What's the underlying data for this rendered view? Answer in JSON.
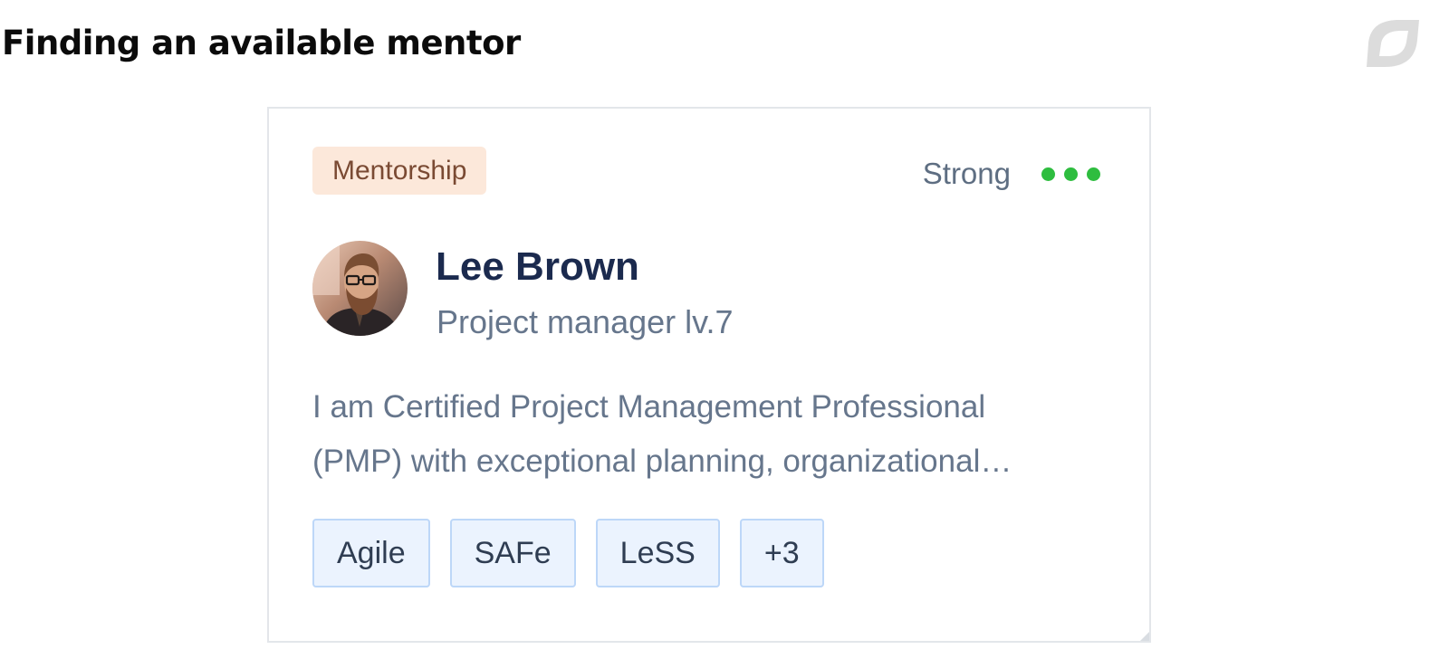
{
  "page": {
    "title": "Finding an available mentor"
  },
  "card": {
    "category_tag": "Mentorship",
    "match": {
      "label": "Strong",
      "level": 3,
      "max_level": 3,
      "dot_color": "#2ebd3f"
    },
    "mentor": {
      "name": "Lee Brown",
      "role": "Project manager lv.7",
      "bio_line_1": "I am Certified Project Management Professional",
      "bio_line_2": "(PMP) with exceptional planning, organizational…"
    },
    "skills": [
      {
        "label": "Agile"
      },
      {
        "label": "SAFe"
      },
      {
        "label": "LeSS"
      },
      {
        "label": "+3"
      }
    ]
  },
  "icons": {
    "brand_logo": "leaf-logo-icon",
    "match_dots": "status-dot-icon",
    "resize": "resize-corner-icon"
  },
  "colors": {
    "tag_background": "#fce8da",
    "chip_background": "#ebf3fe",
    "chip_border": "#bdd7f8",
    "name_text": "#1b2a4e"
  }
}
